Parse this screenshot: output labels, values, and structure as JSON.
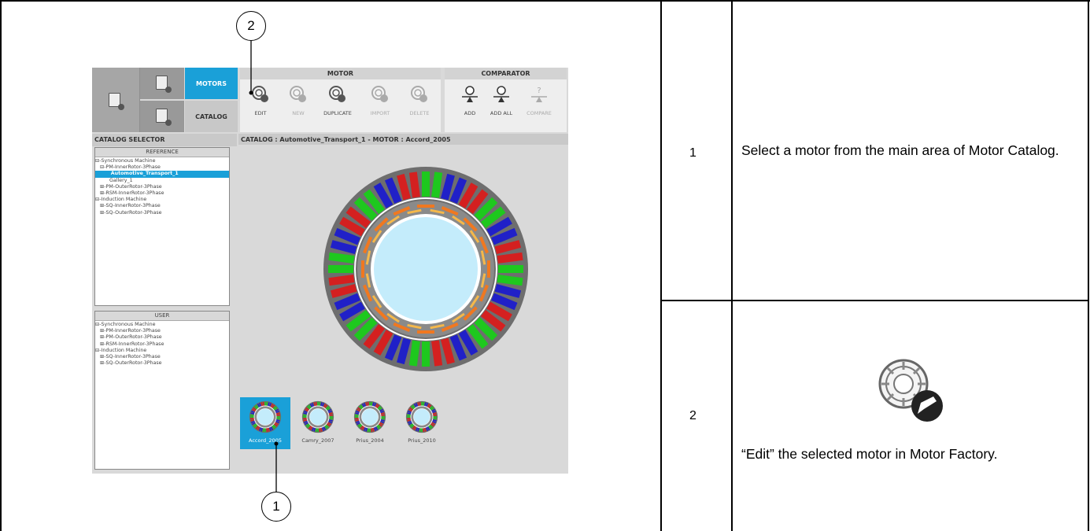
{
  "app": {
    "tabs": {
      "motors": "MOTORS",
      "catalog": "CATALOG"
    },
    "motor_panel": {
      "title": "MOTOR",
      "tools": [
        {
          "label": "EDIT",
          "enabled": true,
          "icon": "edit-motor-icon"
        },
        {
          "label": "NEW",
          "enabled": false,
          "icon": "new-motor-icon"
        },
        {
          "label": "DUPLICATE",
          "enabled": true,
          "icon": "duplicate-motor-icon"
        },
        {
          "label": "IMPORT",
          "enabled": false,
          "icon": "import-motor-icon"
        },
        {
          "label": "DELETE",
          "enabled": false,
          "icon": "delete-motor-icon"
        }
      ]
    },
    "comparator_panel": {
      "title": "COMPARATOR",
      "tools": [
        {
          "label": "ADD",
          "enabled": true,
          "icon": "add-compare-icon"
        },
        {
          "label": "ADD ALL",
          "enabled": true,
          "icon": "add-all-compare-icon"
        },
        {
          "label": "COMPARE",
          "enabled": false,
          "icon": "compare-icon"
        }
      ]
    },
    "catalog_selector": {
      "title": "CATALOG SELECTOR",
      "reference": {
        "header": "REFERENCE",
        "items": [
          "⊟-Synchronous Machine",
          "   ⊟-PM-InnerRotor-3Phase",
          "         Automotive_Transport_1",
          "         Gallery_1",
          "   ⊞-PM-OuterRotor-3Phase",
          "   ⊞-RSM-InnerRotor-3Phase",
          "⊟-Induction Machine",
          "   ⊞-SQ-InnerRotor-3Phase",
          "   ⊞-SQ-OuterRotor-3Phase"
        ],
        "selected_index": 2
      },
      "user": {
        "header": "USER",
        "items": [
          "⊟-Synchronous Machine",
          "   ⊞-PM-InnerRotor-3Phase",
          "   ⊞-PM-OuterRotor-3Phase",
          "   ⊞-RSM-InnerRotor-3Phase",
          "⊟-Induction Machine",
          "   ⊞-SQ-InnerRotor-3Phase",
          "   ⊞-SQ-OuterRotor-3Phase"
        ]
      }
    },
    "viewer_title": "CATALOG : Automotive_Transport_1   -   MOTOR : Accord_2005",
    "thumbnails": [
      {
        "label": "Accord_2005",
        "selected": true
      },
      {
        "label": "Camry_2007",
        "selected": false
      },
      {
        "label": "Prius_2004",
        "selected": false
      },
      {
        "label": "Prius_2010",
        "selected": false
      }
    ],
    "colors": {
      "accent": "#1aa0d8",
      "phase_red": "#d42020",
      "phase_green": "#1ec81e",
      "phase_blue": "#2020c8",
      "magnet_orange": "#f07820",
      "magnet_yellow": "#f5b84a",
      "bore": "#c4ecfb"
    }
  },
  "callouts": [
    "2",
    "1"
  ],
  "rows": [
    {
      "number": "1",
      "text": "Select a motor from the main area of Motor Catalog."
    },
    {
      "number": "2",
      "text": "“Edit” the selected motor in Motor Factory.",
      "icon": "edit-motor-icon"
    }
  ]
}
